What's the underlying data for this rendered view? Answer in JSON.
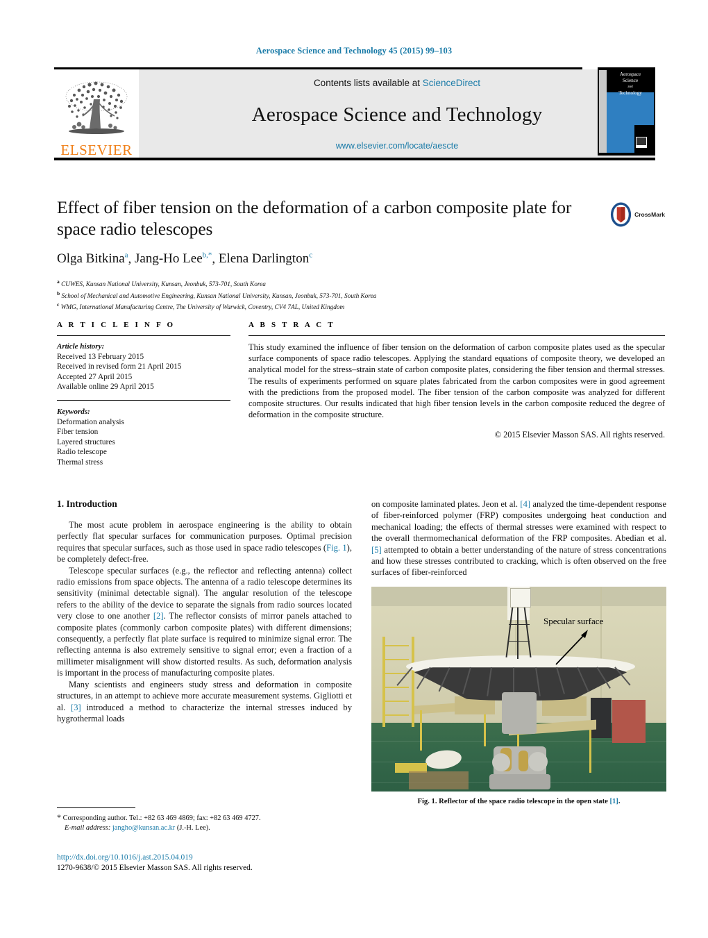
{
  "running_head": "Aerospace Science and Technology 45 (2015) 99–103",
  "masthead": {
    "publisher_logo_text": "ELSEVIER",
    "contents_prefix": "Contents lists available at ",
    "contents_link": "ScienceDirect",
    "journal_title": "Aerospace Science and Technology",
    "journal_url": "www.elsevier.com/locate/aescte",
    "cover_line1": "Aerospace",
    "cover_line2": "Science",
    "cover_line3": "and",
    "cover_line4": "Technology"
  },
  "article": {
    "title": "Effect of fiber tension on the deformation of a carbon composite plate for space radio telescopes",
    "crossmark_label": "CrossMark",
    "authors": [
      {
        "name": "Olga Bitkina",
        "sup": "a"
      },
      {
        "name": "Jang-Ho Lee",
        "sup": "b,*"
      },
      {
        "name": "Elena Darlington",
        "sup": "c"
      }
    ],
    "affiliations": [
      {
        "marker": "a",
        "text": "CUWES, Kunsan National University, Kunsan, Jeonbuk, 573-701, South Korea"
      },
      {
        "marker": "b",
        "text": "School of Mechanical and Automotive Engineering, Kunsan National University, Kunsan, Jeonbuk, 573-701, South Korea"
      },
      {
        "marker": "c",
        "text": "WMG, International Manufacturing Centre, The University of Warwick, Coventry, CV4 7AL, United Kingdom"
      }
    ]
  },
  "article_info": {
    "heading": "A R T I C L E   I N F O",
    "history_label": "Article history:",
    "history": [
      "Received 13 February 2015",
      "Received in revised form 21 April 2015",
      "Accepted 27 April 2015",
      "Available online 29 April 2015"
    ],
    "keywords_label": "Keywords:",
    "keywords": [
      "Deformation analysis",
      "Fiber tension",
      "Layered structures",
      "Radio telescope",
      "Thermal stress"
    ]
  },
  "abstract": {
    "heading": "A B S T R A C T",
    "text": "This study examined the influence of fiber tension on the deformation of carbon composite plates used as the specular surface components of space radio telescopes. Applying the standard equations of composite theory, we developed an analytical model for the stress–strain state of carbon composite plates, considering the fiber tension and thermal stresses. The results of experiments performed on square plates fabricated from the carbon composites were in good agreement with the predictions from the proposed model. The fiber tension of the carbon composite was analyzed for different composite structures. Our results indicated that high fiber tension levels in the carbon composite reduced the degree of deformation in the composite structure.",
    "copyright": "© 2015 Elsevier Masson SAS. All rights reserved."
  },
  "body": {
    "section_title": "1. Introduction",
    "left_paragraphs": [
      {
        "parts": [
          {
            "t": "The most acute problem in aerospace engineering is the ability to obtain perfectly flat specular surfaces for communication purposes. Optimal precision requires that specular surfaces, such as those used in space radio telescopes ("
          },
          {
            "t": "Fig. 1",
            "link": true
          },
          {
            "t": "), be completely defect-free."
          }
        ]
      },
      {
        "parts": [
          {
            "t": "Telescope specular surfaces (e.g., the reflector and reflecting antenna) collect radio emissions from space objects. The antenna of a radio telescope determines its sensitivity (minimal detectable signal). The angular resolution of the telescope refers to the ability of the device to separate the signals from radio sources located very close to one another "
          },
          {
            "t": "[2]",
            "link": true
          },
          {
            "t": ". The reflector consists of mirror panels attached to composite plates (commonly carbon composite plates) with different dimensions; consequently, a perfectly flat plate surface is required to minimize signal error. The reflecting antenna is also extremely sensitive to signal error; even a fraction of a millimeter misalignment will show distorted results. As such, deformation analysis is important in the process of manufacturing composite plates."
          }
        ]
      },
      {
        "parts": [
          {
            "t": "Many scientists and engineers study stress and deformation in composite structures, in an attempt to achieve more accurate measurement systems. Gigliotti et al. "
          },
          {
            "t": "[3]",
            "link": true
          },
          {
            "t": " introduced a method to characterize the internal stresses induced by hygrothermal loads"
          }
        ]
      }
    ],
    "right_paragraphs": [
      {
        "parts": [
          {
            "t": "on composite laminated plates. Jeon et al. "
          },
          {
            "t": "[4]",
            "link": true
          },
          {
            "t": " analyzed the time-dependent response of fiber-reinforced polymer (FRP) composites undergoing heat conduction and mechanical loading; the effects of thermal stresses were examined with respect to the overall thermomechanical deformation of the FRP composites. Abedian et al. "
          },
          {
            "t": "[5]",
            "link": true
          },
          {
            "t": " attempted to obtain a better understanding of the nature of stress concentrations and how these stresses contributed to cracking, which is often observed on the free surfaces of fiber-reinforced"
          }
        ]
      }
    ]
  },
  "figure": {
    "annotation": "Specular surface",
    "caption_main": "Fig. 1. Reflector of the space radio telescope in the open state ",
    "caption_ref": "[1]",
    "caption_end": "."
  },
  "footnote": {
    "star": "*",
    "line1": "Corresponding author. Tel.: +82 63 469 4869; fax: +82 63 469 4727.",
    "email_label": "E-mail address:",
    "email": "jangho@kunsan.ac.kr",
    "email_suffix": " (J.-H. Lee)."
  },
  "doi": {
    "url": "http://dx.doi.org/10.1016/j.ast.2015.04.019",
    "issn_line": "1270-9638/© 2015 Elsevier Masson SAS. All rights reserved."
  },
  "colors": {
    "link": "#1a7ba8",
    "elsevier_orange": "#F08019",
    "cover_blue": "#2f7fc1"
  }
}
